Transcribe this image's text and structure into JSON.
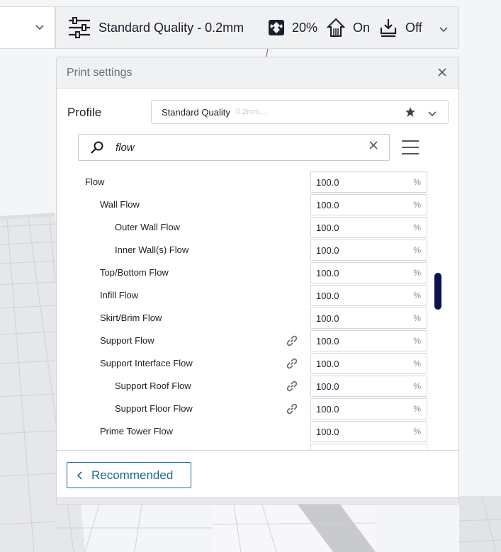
{
  "toolbar": {
    "profile_label": "Standard Quality - 0.2mm",
    "infill_value": "20%",
    "support_value": "On",
    "adhesion_value": "Off"
  },
  "panel": {
    "title": "Print settings",
    "profile_label": "Profile",
    "profile_name": "Standard Quality",
    "profile_suffix": "0.2mm...",
    "search_value": "flow"
  },
  "settings": [
    {
      "label": "Flow",
      "value": "100.0",
      "unit": "%",
      "level": 0,
      "linked": false
    },
    {
      "label": "Wall Flow",
      "value": "100.0",
      "unit": "%",
      "level": 1,
      "linked": false
    },
    {
      "label": "Outer Wall Flow",
      "value": "100.0",
      "unit": "%",
      "level": 2,
      "linked": false
    },
    {
      "label": "Inner Wall(s) Flow",
      "value": "100.0",
      "unit": "%",
      "level": 2,
      "linked": false
    },
    {
      "label": "Top/Bottom Flow",
      "value": "100.0",
      "unit": "%",
      "level": 1,
      "linked": false
    },
    {
      "label": "Infill Flow",
      "value": "100.0",
      "unit": "%",
      "level": 1,
      "linked": false
    },
    {
      "label": "Skirt/Brim Flow",
      "value": "100.0",
      "unit": "%",
      "level": 1,
      "linked": false
    },
    {
      "label": "Support Flow",
      "value": "100.0",
      "unit": "%",
      "level": 1,
      "linked": true
    },
    {
      "label": "Support Interface Flow",
      "value": "100.0",
      "unit": "%",
      "level": 1,
      "linked": true
    },
    {
      "label": "Support Roof Flow",
      "value": "100.0",
      "unit": "%",
      "level": 2,
      "linked": true
    },
    {
      "label": "Support Floor Flow",
      "value": "100.0",
      "unit": "%",
      "level": 2,
      "linked": true
    },
    {
      "label": "Prime Tower Flow",
      "value": "100.0",
      "unit": "%",
      "level": 1,
      "linked": false
    }
  ],
  "footer": {
    "recommended_label": "Recommended"
  },
  "colors": {
    "accent": "#1a6a9a",
    "scrollbar": "#0c1152",
    "link_icon": "#6d6f78"
  }
}
